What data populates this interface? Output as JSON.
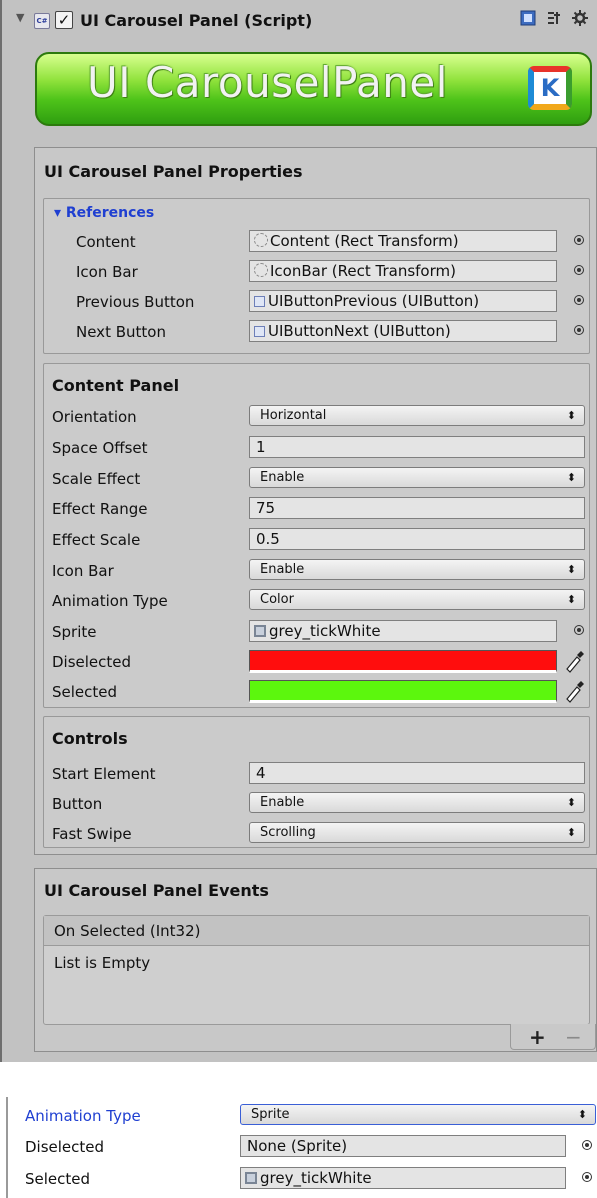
{
  "header": {
    "title": "UI Carousel Panel (Script)",
    "enabled": true,
    "icons": [
      "fold-arrow-icon",
      "script-icon",
      "help-book-icon",
      "settings-gear-icon"
    ]
  },
  "banner": {
    "text": "UI CarouselPanel",
    "logo": "K"
  },
  "properties": {
    "title": "UI Carousel Panel Properties",
    "references": {
      "header": "References",
      "rows": [
        {
          "label": "Content",
          "value": "Content (Rect Transform)",
          "icon": "rect-transform-icon"
        },
        {
          "label": "Icon Bar",
          "value": "IconBar (Rect Transform)",
          "icon": "rect-transform-icon"
        },
        {
          "label": "Previous Button",
          "value": "UIButtonPrevious (UIButton)",
          "icon": "script-icon"
        },
        {
          "label": "Next Button",
          "value": "UIButtonNext (UIButton)",
          "icon": "script-icon"
        }
      ]
    },
    "content_panel": {
      "title": "Content Panel",
      "orientation": {
        "label": "Orientation",
        "value": "Horizontal"
      },
      "space_offset": {
        "label": "Space Offset",
        "value": "1"
      },
      "scale_effect": {
        "label": "Scale Effect",
        "value": "Enable"
      },
      "effect_range": {
        "label": "Effect Range",
        "value": "75"
      },
      "effect_scale": {
        "label": "Effect Scale",
        "value": "0.5"
      },
      "icon_bar": {
        "label": "Icon Bar",
        "value": "Enable"
      },
      "animation_type": {
        "label": "Animation Type",
        "value": "Color"
      },
      "sprite": {
        "label": "Sprite",
        "value": "grey_tickWhite"
      },
      "diselected": {
        "label": "Diselected",
        "color": "#ff0d0d"
      },
      "selected": {
        "label": "Selected",
        "color": "#5cf70d"
      }
    },
    "controls": {
      "title": "Controls",
      "start_element": {
        "label": "Start Element",
        "value": "4"
      },
      "button": {
        "label": "Button",
        "value": "Enable"
      },
      "fast_swipe": {
        "label": "Fast Swipe",
        "value": "Scrolling"
      }
    }
  },
  "events": {
    "title": "UI Carousel Panel Events",
    "list_header": "On Selected (Int32)",
    "empty_text": "List is Empty",
    "add_label": "+",
    "remove_label": "−"
  },
  "alt_view": {
    "animation_type": {
      "label": "Animation Type",
      "value": "Sprite"
    },
    "diselected": {
      "label": "Diselected",
      "value": "None (Sprite)"
    },
    "selected": {
      "label": "Selected",
      "value": "grey_tickWhite"
    }
  },
  "colors": {
    "accent_label": "#1f3fd1",
    "panel_bg": "#c8c8c8"
  }
}
